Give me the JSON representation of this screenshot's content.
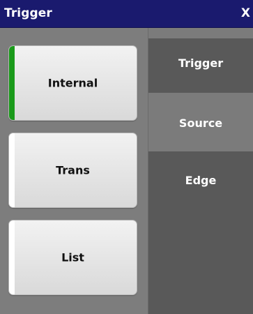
{
  "window": {
    "title": "Trigger",
    "close_label": "X"
  },
  "buttons": [
    {
      "label": "Internal",
      "selected": true,
      "accent_color": "#1a9a1a"
    },
    {
      "label": "Trans",
      "selected": false,
      "accent_color": "#ffffff"
    },
    {
      "label": "List",
      "selected": false,
      "accent_color": "#ffffff"
    }
  ],
  "tabs": [
    {
      "label": "Trigger",
      "active": false
    },
    {
      "label": "Source",
      "active": true
    },
    {
      "label": "Edge",
      "active": false
    }
  ],
  "colors": {
    "titlebar": "#1a1a6e",
    "panel": "#7d7d7d",
    "tab_active": "#7b7b7b",
    "tab_inactive": "#595959"
  }
}
